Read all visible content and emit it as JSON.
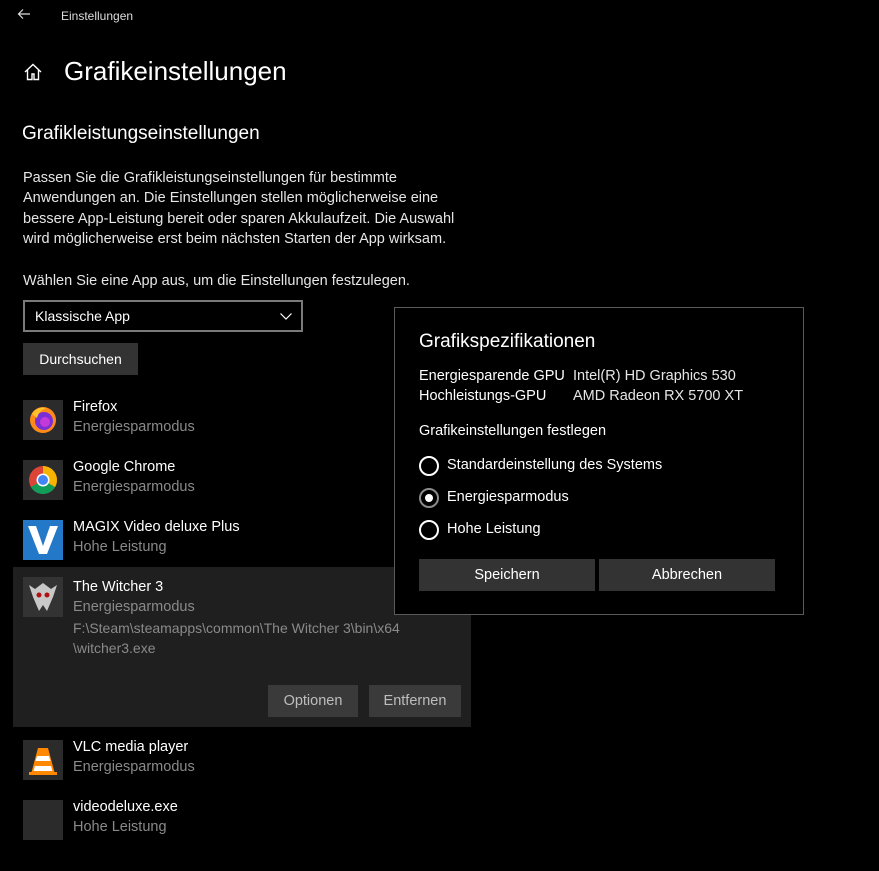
{
  "window": {
    "title": "Einstellungen"
  },
  "header": {
    "title": "Grafikeinstellungen"
  },
  "section": {
    "title": "Grafikleistungseinstellungen",
    "description": "Passen Sie die Grafikleistungseinstellungen für bestimmte Anwendungen an. Die Einstellungen stellen möglicherweise eine bessere App-Leistung bereit oder sparen Akkulaufzeit. Die Auswahl wird möglicherweise erst beim nächsten Starten der App wirksam.",
    "choose_label": "Wählen Sie eine App aus, um die Einstellungen festzulegen.",
    "app_type_select": "Klassische App",
    "browse_label": "Durchsuchen"
  },
  "apps": [
    {
      "name": "Firefox",
      "mode": "Energiesparmodus",
      "icon": "firefox-icon"
    },
    {
      "name": "Google Chrome",
      "mode": "Energiesparmodus",
      "icon": "chrome-icon"
    },
    {
      "name": "MAGIX Video deluxe Plus",
      "mode": "Hohe Leistung",
      "icon": "magix-icon"
    },
    {
      "name": "The Witcher 3",
      "mode": "Energiesparmodus",
      "path": "F:\\Steam\\steamapps\\common\\The Witcher 3\\bin\\x64\\witcher3.exe",
      "icon": "witcher-icon"
    },
    {
      "name": "VLC media player",
      "mode": "Energiesparmodus",
      "icon": "vlc-icon"
    },
    {
      "name": "videodeluxe.exe",
      "mode": "Hohe Leistung",
      "icon": "generic-app-icon"
    }
  ],
  "selected_item": {
    "options_label": "Optionen",
    "remove_label": "Entfernen"
  },
  "dialog": {
    "title": "Grafikspezifikationen",
    "power_saving_gpu_label": "Energiesparende GPU",
    "power_saving_gpu_value": "Intel(R) HD Graphics 530",
    "high_perf_gpu_label": "Hochleistungs-GPU",
    "high_perf_gpu_value": "AMD Radeon RX 5700 XT",
    "subtitle": "Grafikeinstellungen festlegen",
    "options": [
      "Standardeinstellung des Systems",
      "Energiesparmodus",
      "Hohe Leistung"
    ],
    "selected_option": "Energiesparmodus",
    "save_label": "Speichern",
    "cancel_label": "Abbrechen"
  },
  "colors": {
    "background": "#000000",
    "button": "#333333",
    "selected_row": "#1f1f1f",
    "secondary_text": "#8a8a8a"
  }
}
